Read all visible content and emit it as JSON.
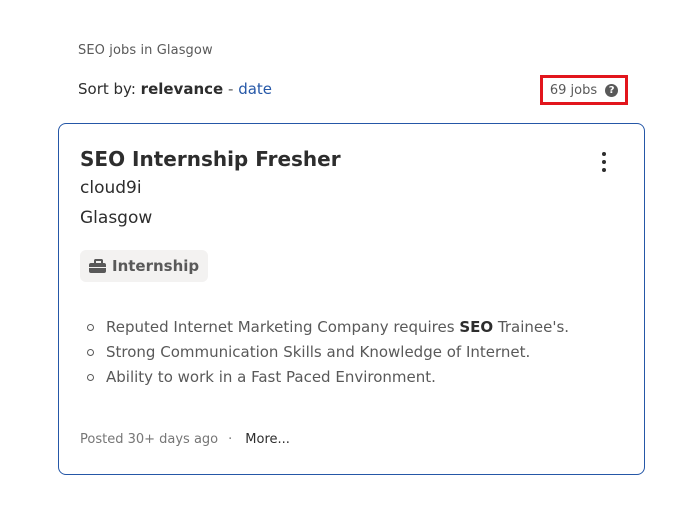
{
  "breadcrumb": "SEO jobs in Glasgow",
  "sort": {
    "label": "Sort by:",
    "current": "relevance",
    "separator": "-",
    "alternate": "date"
  },
  "job_count": {
    "text": "69 jobs",
    "help_glyph": "?",
    "highlight_color": "#e2161d"
  },
  "job": {
    "title": "SEO Internship Fresher",
    "company": "cloud9i",
    "location": "Glasgow",
    "tag": {
      "icon": "briefcase-icon",
      "label": "Internship"
    },
    "snippet": [
      {
        "text": "Reputed Internet Marketing Company requires ",
        "bold": "SEO",
        "after": " Trainee's."
      },
      {
        "text": "Strong Communication Skills and Knowledge of Internet."
      },
      {
        "text": "Ability to work in a Fast Paced Environment."
      }
    ],
    "posted": "Posted 30+ days ago",
    "footer_separator": "·",
    "more": "More..."
  },
  "colors": {
    "link": "#2557a7",
    "card_border": "#2557a7",
    "text": "#2d2d2d",
    "muted": "#595959"
  }
}
